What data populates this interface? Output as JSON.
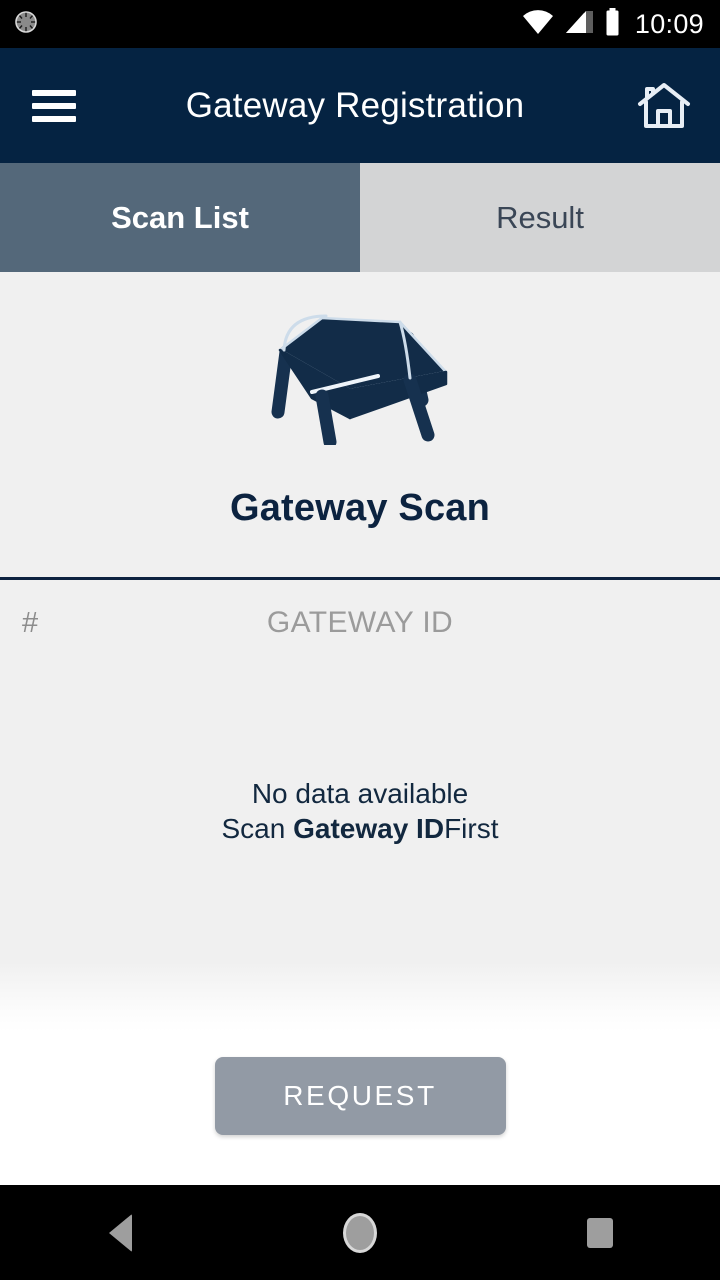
{
  "statusbar": {
    "clock": "10:09",
    "icons": [
      "progress-spinner-icon",
      "wifi-icon",
      "cellular-signal-icon",
      "battery-icon"
    ]
  },
  "appbar": {
    "menu_icon": "hamburger-menu-icon",
    "title": "Gateway Registration",
    "home_icon": "home-icon",
    "background_color": "#052342"
  },
  "tabs": [
    {
      "label": "Scan List",
      "active": true,
      "background_color": "#54687a"
    },
    {
      "label": "Result",
      "active": false,
      "background_color": "#d3d4d5"
    }
  ],
  "hero": {
    "illustration": "gateway-device-icon",
    "title": "Gateway Scan",
    "title_color": "#0c2340"
  },
  "table": {
    "columns": [
      {
        "key": "index",
        "label": "#"
      },
      {
        "key": "gateway_id",
        "label": "GATEWAY ID"
      }
    ],
    "rows": []
  },
  "empty_state": {
    "line1": "No data available",
    "line2_prefix": "Scan ",
    "line2_strong": "Gateway ID",
    "line2_suffix": "First"
  },
  "footer": {
    "request_label": "REQUEST",
    "request_enabled": false,
    "request_color": "#929aa5"
  },
  "navbar": {
    "back_label": "back-button",
    "home_label": "home-button",
    "recents_label": "recents-button"
  }
}
